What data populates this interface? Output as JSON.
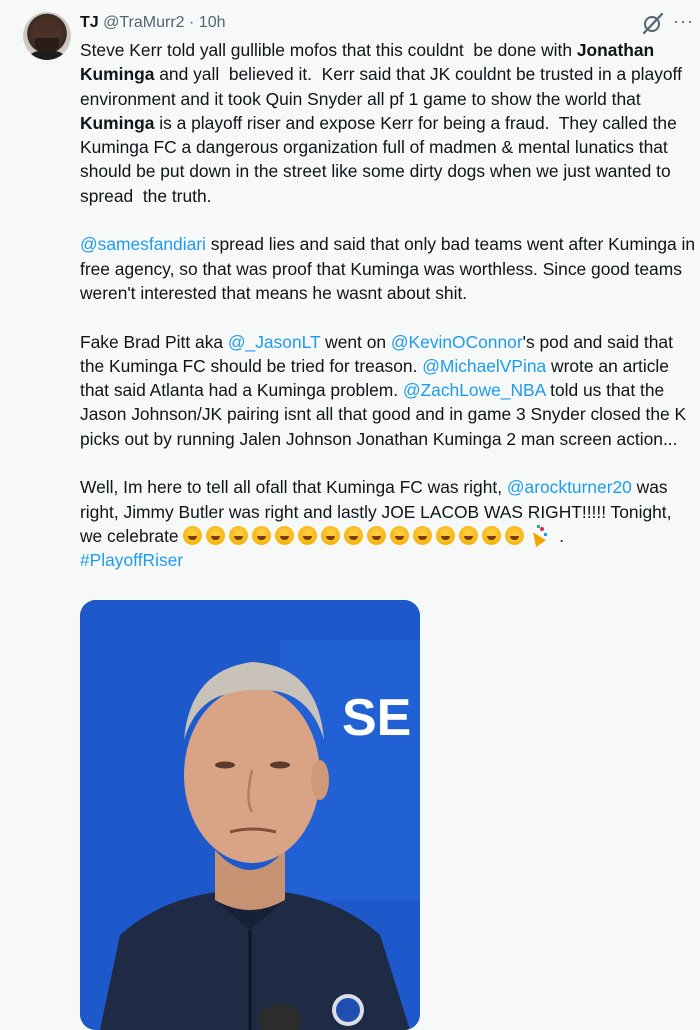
{
  "tweet": {
    "author_name": "TJ",
    "handle": "@TraMurr2",
    "separator": "·",
    "time": "10h",
    "grok_icon": "grok-slash-icon",
    "more_icon": "more-horizontal-icon",
    "p1": {
      "s1": "Steve Kerr told yall gullible mofos that this couldnt  be done with ",
      "b1": "Jonathan Kuminga",
      "s2": " and yall  believed it.  Kerr said that JK couldnt be trusted in a playoff environment and it took Quin Snyder all pf 1 game to show the world that ",
      "b2": "Kuminga",
      "s3": " is a playoff riser and expose Kerr for being a fraud.  They called the Kuminga FC a dangerous organization full of madmen & mental lunatics that should be put down in the street like some dirty dogs when we just wanted to spread  the truth."
    },
    "p2": {
      "m1": "@samesfandiari",
      "s1": " spread lies and said that only bad teams went after Kuminga in free agency, so that was proof that Kuminga was worthless. Since good teams weren't interested that means he wasnt about shit."
    },
    "p3": {
      "s1": "Fake Brad Pitt aka ",
      "m1": "@_JasonLT",
      "s2": " went on ",
      "m2": "@KevinOConnor",
      "s3": "'s pod and said that the Kuminga FC should be tried for treason. ",
      "m3": "@MichaelVPina",
      "s4": " wrote an article that said Atlanta had a Kuminga problem. ",
      "m4": "@ZachLowe_NBA",
      "s5": " told us that the Jason Johnson/JK pairing isnt all that good and in game 3 Snyder closed the K picks out by running Jalen Johnson Jonathan Kuminga 2 man screen action..."
    },
    "p4": {
      "s1": "Well, Im here to tell all ofall that Kuminga FC was right, ",
      "m1": "@arockturner20",
      "s2": " was right, Jimmy Butler was right and lastly JOE LACOB WAS RIGHT!!!!! Tonight, we celebrate ",
      "emoji_laugh": "rolling-on-floor-laughing-emoji",
      "emoji_laugh_count": 14,
      "emoji_party": "partying-face-emoji",
      "emoji_popper": "party-popper-emoji",
      "s3": " .",
      "hashtag": "#PlayoffRiser"
    },
    "media": {
      "backdrop_text": "SE",
      "image_subject": "coach-portrait-image"
    }
  },
  "colors": {
    "link": "#1d9bf0",
    "muted": "#536471",
    "background": "#f7f9f9",
    "media_blue": "#1f56c6"
  }
}
